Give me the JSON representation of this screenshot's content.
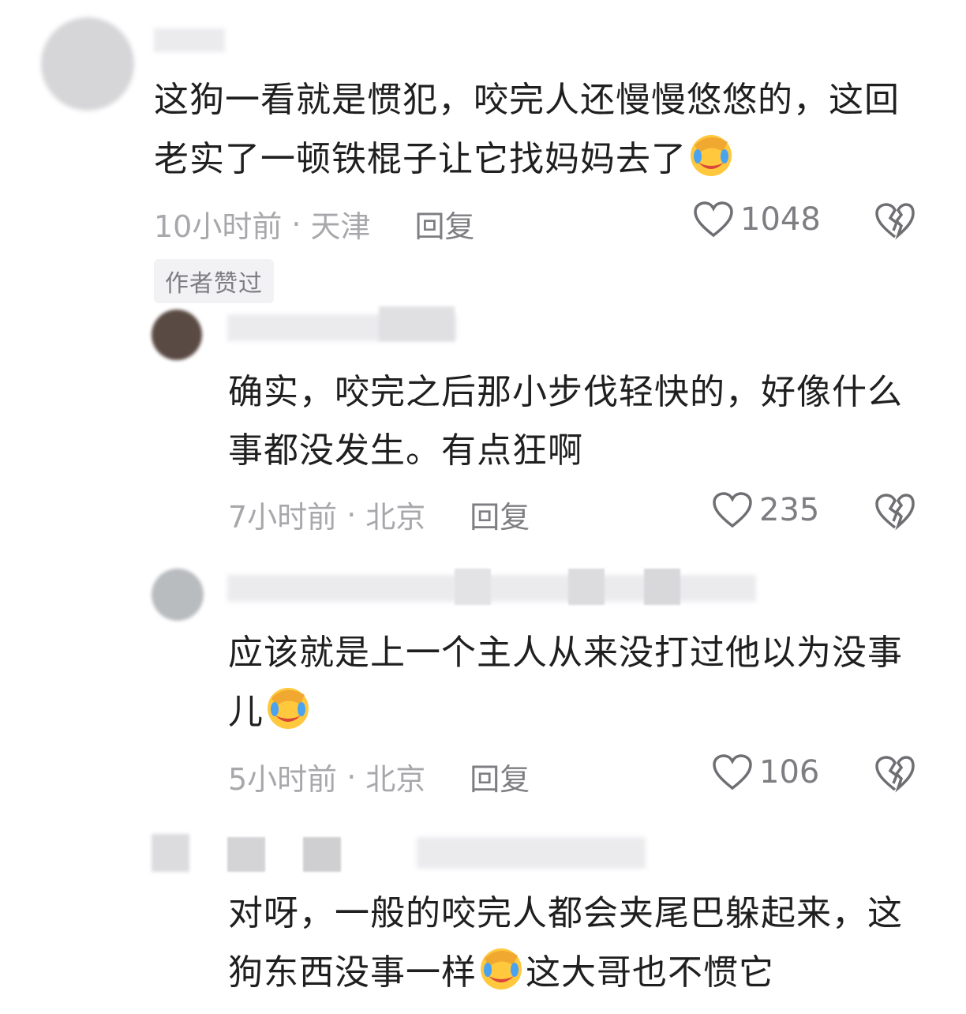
{
  "comments": [
    {
      "text_before_emoji": "这狗一看就是惯犯，咬完人还慢慢悠悠的，这回老实了一顿铁棍子让它找妈妈去了",
      "text_after_emoji": "",
      "time": "10小时前",
      "location": "天津",
      "reply_label": "回复",
      "likes": "1048",
      "author_liked_badge": "作者赞过"
    },
    {
      "text_before_emoji": "确实，咬完之后那小步伐轻快的，好像什么事都没发生。有点狂啊",
      "text_after_emoji": "",
      "time": "7小时前",
      "location": "北京",
      "reply_label": "回复",
      "likes": "235"
    },
    {
      "text_before_emoji": "应该就是上一个主人从来没打过他以为没事儿",
      "text_after_emoji": "",
      "time": "5小时前",
      "location": "北京",
      "reply_label": "回复",
      "likes": "106"
    },
    {
      "text_before_emoji": "对呀，一般的咬完人都会夹尾巴躲起来，这狗东西没事一样",
      "text_after_emoji": "这大哥也不惯它"
    }
  ],
  "separator": "·",
  "icons": {
    "like": "heart-outline-icon",
    "dislike": "broken-heart-icon",
    "emoji": "facepalm-laugh-emoji-icon"
  },
  "colors": {
    "text": "#1f1f1f",
    "meta": "#a8a8ac",
    "reply": "#7d7d82"
  }
}
